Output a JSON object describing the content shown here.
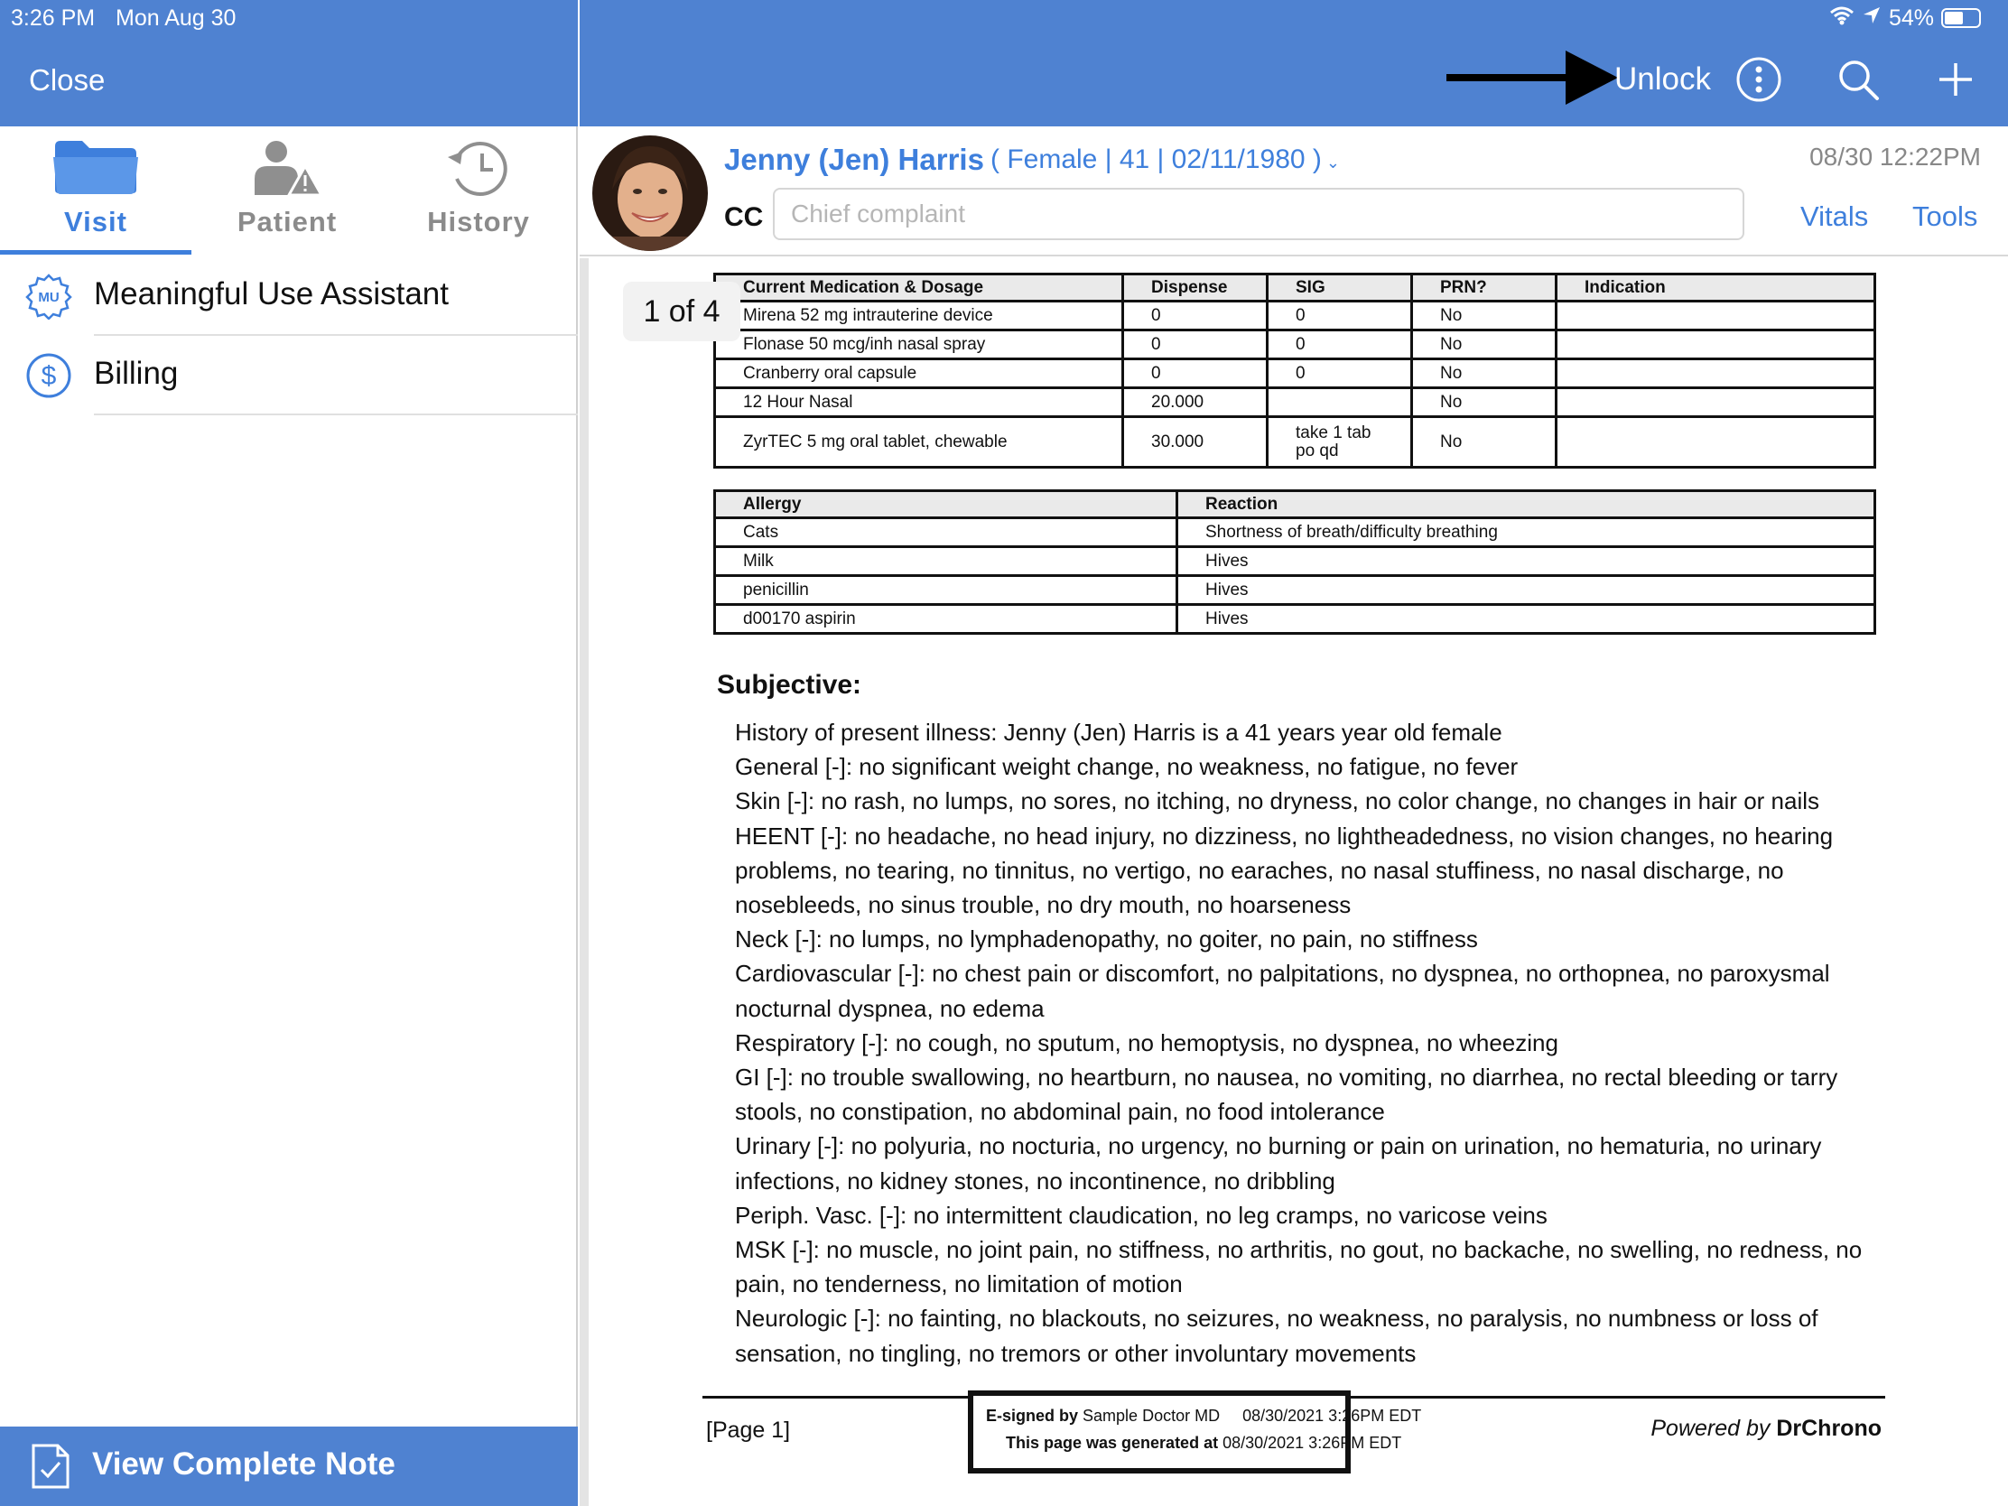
{
  "status_bar": {
    "time": "3:26 PM",
    "date": "Mon Aug 30",
    "battery": "54%",
    "battery_level": 0.54
  },
  "left_pane": {
    "close_label": "Close",
    "tabs": [
      {
        "label": "Visit",
        "icon": "folder-icon",
        "active": true
      },
      {
        "label": "Patient",
        "icon": "patient-alert-icon",
        "active": false
      },
      {
        "label": "History",
        "icon": "history-clock-icon",
        "active": false
      }
    ],
    "items": [
      {
        "label": "Meaningful Use Assistant",
        "icon": "mu-badge-icon",
        "icon_text": "MU"
      },
      {
        "label": "Billing",
        "icon": "dollar-icon"
      }
    ],
    "view_note_label": "View Complete Note"
  },
  "header": {
    "unlock_label": "Unlock",
    "accent_color": "#4f82d1"
  },
  "patient": {
    "name": "Jenny (Jen) Harris",
    "demographics": "( Female | 41 | 02/11/1980 )",
    "visit_time": "08/30 12:22PM",
    "cc_label": "CC",
    "cc_placeholder": "Chief complaint",
    "vitals_label": "Vitals",
    "tools_label": "Tools"
  },
  "document": {
    "page_badge": "1 of 4",
    "medications": {
      "headers": [
        "Current Medication & Dosage",
        "Dispense",
        "SIG",
        "PRN?",
        "Indication"
      ],
      "rows": [
        [
          "Mirena 52 mg intrauterine device",
          "0",
          "0",
          "No",
          ""
        ],
        [
          "Flonase 50 mcg/inh nasal spray",
          "0",
          "0",
          "No",
          ""
        ],
        [
          "Cranberry oral capsule",
          "0",
          "0",
          "No",
          ""
        ],
        [
          "12 Hour Nasal",
          "20.000",
          "",
          "No",
          ""
        ],
        [
          "ZyrTEC 5 mg oral tablet, chewable",
          "30.000",
          "take 1 tab po qd",
          "No",
          ""
        ]
      ]
    },
    "allergies": {
      "headers": [
        "Allergy",
        "Reaction"
      ],
      "rows": [
        [
          "Cats",
          "Shortness of breath/difficulty breathing"
        ],
        [
          "Milk",
          "Hives"
        ],
        [
          "penicillin",
          "Hives"
        ],
        [
          "d00170 aspirin",
          "Hives"
        ]
      ]
    },
    "subjective": {
      "title": "Subjective:",
      "lines": [
        "History of present illness: Jenny (Jen) Harris is a 41 years year old female",
        "General [-]: no significant weight change, no weakness, no fatigue, no fever",
        "Skin [-]: no rash, no lumps, no sores, no itching, no dryness, no color change, no changes in hair or nails",
        "HEENT [-]: no headache, no head injury, no dizziness, no lightheadedness, no vision changes, no hearing problems, no tearing, no tinnitus, no vertigo, no earaches, no nasal stuffiness, no nasal discharge, no nosebleeds, no sinus trouble, no dry mouth, no hoarseness",
        "Neck [-]: no lumps, no lymphadenopathy, no goiter, no pain, no stiffness",
        "Cardiovascular [-]: no chest pain or discomfort, no palpitations, no dyspnea, no orthopnea, no paroxysmal nocturnal dyspnea, no edema",
        "Respiratory [-]: no cough, no sputum, no hemoptysis, no dyspnea, no wheezing",
        "GI [-]: no trouble swallowing, no heartburn, no nausea, no vomiting, no diarrhea, no rectal bleeding or tarry stools, no constipation, no abdominal pain, no food intolerance",
        "Urinary [-]: no polyuria, no nocturia, no urgency, no burning or pain on urination, no hematuria, no urinary infections, no kidney stones, no incontinence, no dribbling",
        "Periph. Vasc. [-]: no intermittent claudication, no leg cramps, no varicose veins",
        "MSK [-]: no muscle, no joint pain, no stiffness, no arthritis, no gout, no backache, no swelling, no redness, no pain, no tenderness, no limitation of motion",
        "Neurologic [-]: no fainting, no blackouts, no seizures, no weakness, no paralysis, no numbness or loss of sensation, no tingling, no tremors or other involuntary movements"
      ]
    },
    "footer": {
      "page_label": "[Page 1]",
      "esign_prefix": "E-signed by",
      "esign_name": "Sample Doctor MD",
      "esign_time": "08/30/2021 3:26PM EDT",
      "generated_prefix": "This page was generated at",
      "generated_time": "08/30/2021 3:26PM EDT",
      "powered_prefix": "Powered by",
      "powered_brand": "DrChrono"
    }
  }
}
